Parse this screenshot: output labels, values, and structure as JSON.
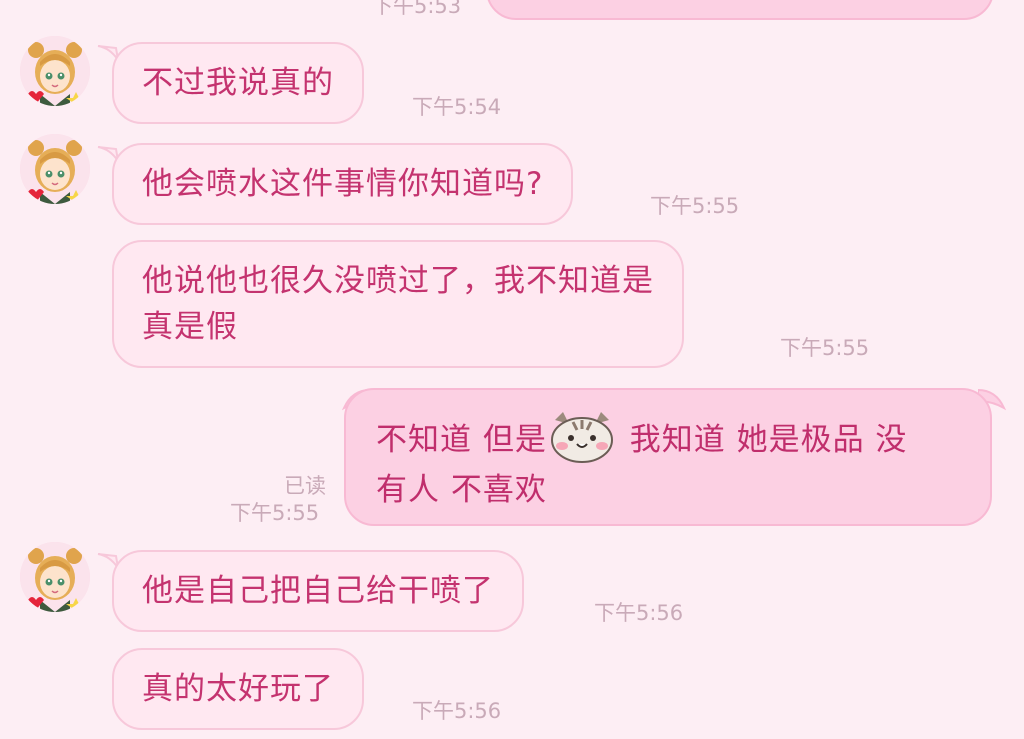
{
  "chat": {
    "prev_time_partial": "下午5:53",
    "messages": [
      {
        "side": "in",
        "text": "不过我说真的",
        "time": "下午5:54"
      },
      {
        "side": "in",
        "text": "他会喷水这件事情你知道吗?",
        "time": "下午5:55"
      },
      {
        "side": "in",
        "line1": "他说他也很久没喷过了，我不知道是",
        "line2": "真是假",
        "time": "下午5:55"
      },
      {
        "side": "out",
        "part1": "不知道 但是",
        "emoji": "cat-face-emoji",
        "part2": " 我知道 她是极品 没",
        "line2": "有人 不喜欢",
        "read": "已读",
        "time": "下午5:55"
      },
      {
        "side": "in",
        "text": "他是自己把自己给干喷了",
        "time": "下午5:56"
      },
      {
        "side": "in",
        "text": "真的太好玩了",
        "time": "下午5:56"
      }
    ]
  },
  "theme": {
    "background": "#fdeef4",
    "bubble_in": "#ffe8f1",
    "bubble_out": "#fcd0e3",
    "text": "#c4336f",
    "meta": "#c9aab8"
  },
  "icons": {
    "avatar": "anime-girl-avatar",
    "emoji": "cat-face-emoji"
  }
}
